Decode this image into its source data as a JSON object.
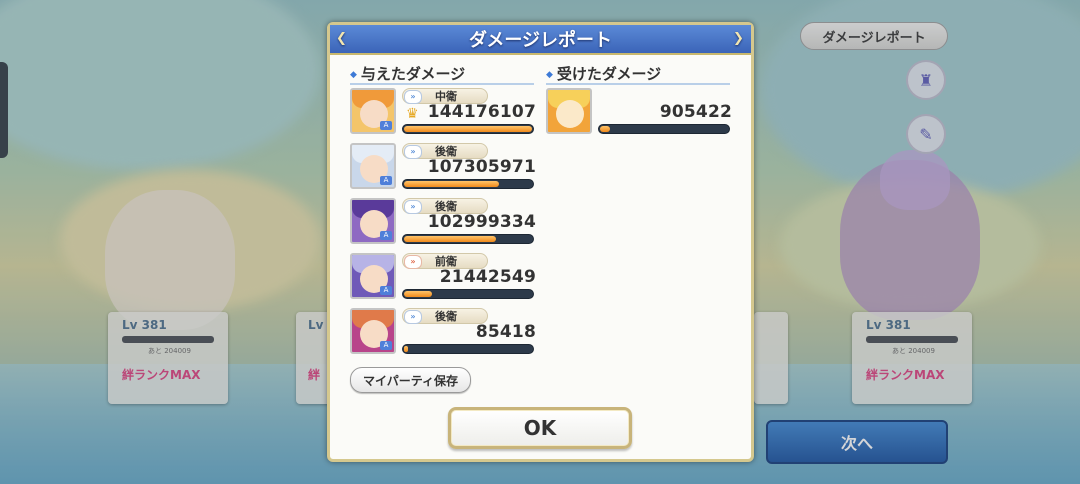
{
  "background": {
    "top_right_button": "ダメージレポート",
    "next_button": "次へ",
    "unit_cards": [
      {
        "level": "Lv 381",
        "sub": "あと 204009",
        "rank": "絆ランクMAX"
      },
      {
        "level": "Lv",
        "sub": "",
        "rank": "絆"
      },
      {
        "level": "Lv 381",
        "sub": "あと 204009",
        "rank": "絆ランクMAX"
      }
    ]
  },
  "dialog": {
    "title": "ダメージレポート",
    "dealt_title": "与えたダメージ",
    "received_title": "受けたダメージ",
    "dealt": [
      {
        "position": "中衛",
        "damage": "144176107",
        "bar": 1.0,
        "top": true,
        "arrow": "blue"
      },
      {
        "position": "後衛",
        "damage": "107305971",
        "bar": 0.74,
        "top": false,
        "arrow": "blue"
      },
      {
        "position": "後衛",
        "damage": "102999334",
        "bar": 0.72,
        "top": false,
        "arrow": "blue"
      },
      {
        "position": "前衛",
        "damage": "21442549",
        "bar": 0.22,
        "top": false,
        "arrow": "red"
      },
      {
        "position": "後衛",
        "damage": "85418",
        "bar": 0.02,
        "top": false,
        "arrow": "blue"
      }
    ],
    "received": [
      {
        "damage": "905422",
        "bar": 0.08
      }
    ],
    "party_save_label": "マイパーティ保存",
    "ok_label": "OK"
  },
  "colors": {
    "header_blue": "#3b64b8",
    "bar_orange": "#f08a1c",
    "bar_track": "#2d3a4a",
    "frame_gold": "#d5c88e"
  }
}
